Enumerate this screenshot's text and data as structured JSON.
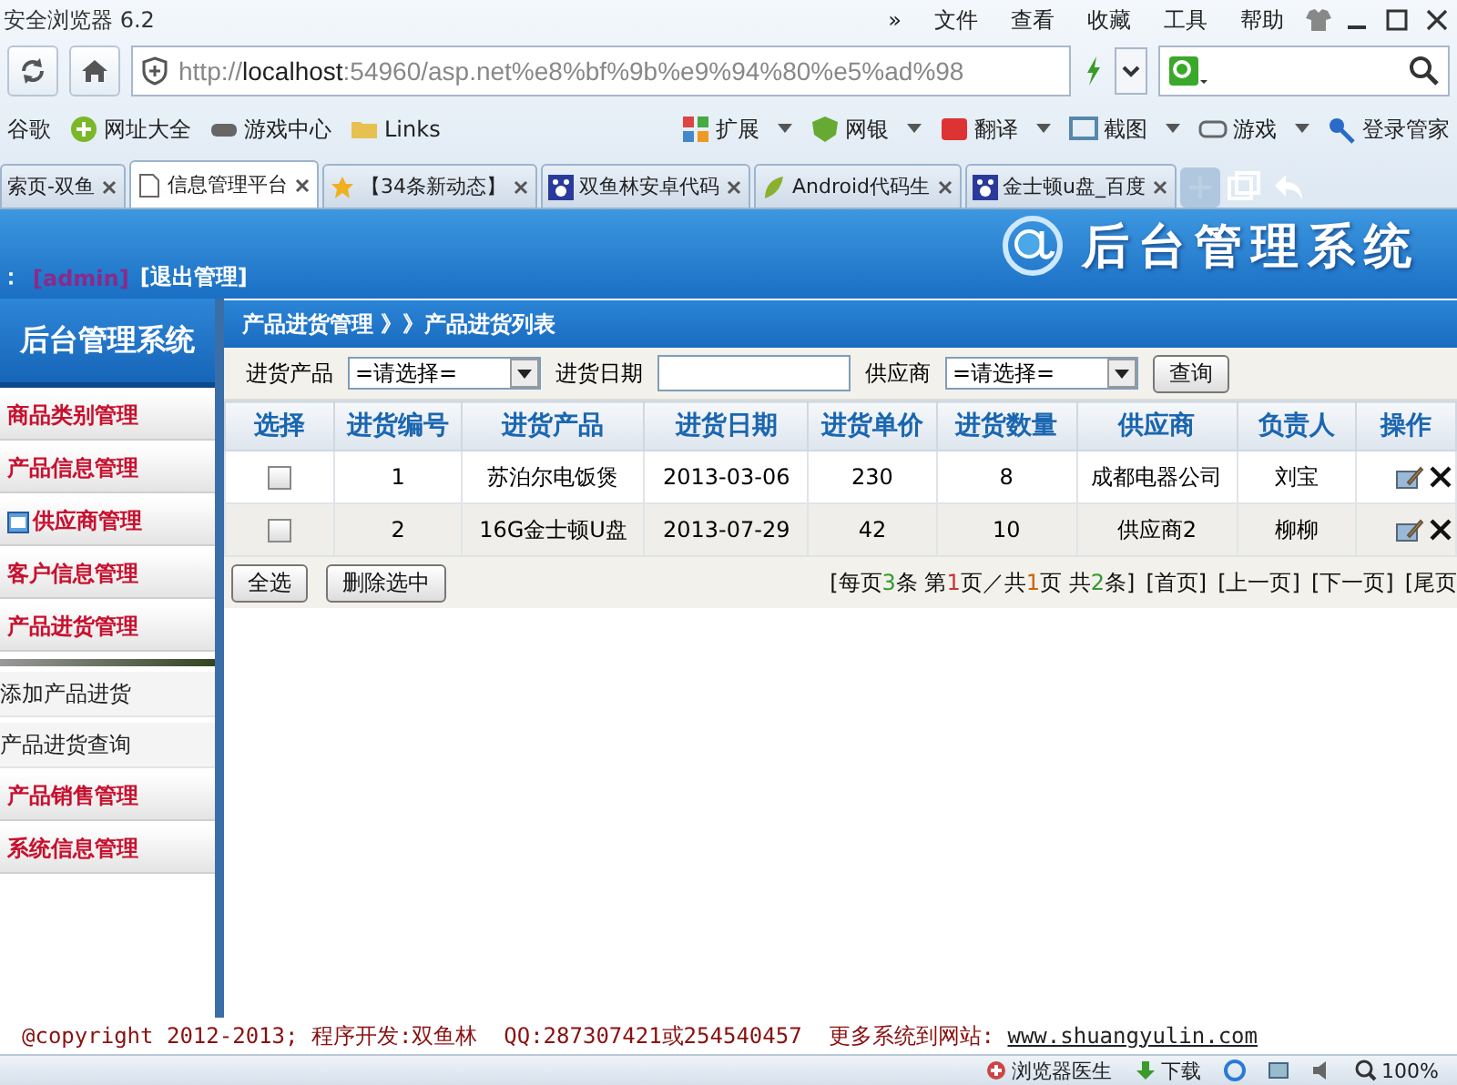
{
  "browser": {
    "title": "安全浏览器 6.2",
    "menu": [
      "»",
      "文件",
      "查看",
      "收藏",
      "工具",
      "帮助"
    ],
    "url_prefix": "http://",
    "url_host": "localhost",
    "url_rest": ":54960/asp.net%e8%bf%9b%e9%94%80%e5%ad%98",
    "bookmarks": [
      "谷歌",
      "网址大全",
      "游戏中心",
      "Links"
    ],
    "tools": [
      "扩展",
      "网银",
      "翻译",
      "截图",
      "游戏",
      "登录管家"
    ],
    "tabs": [
      {
        "label": "索页-双鱼",
        "selected": false
      },
      {
        "label": "信息管理平台",
        "selected": true
      },
      {
        "label": "【34条新动态】",
        "selected": false
      },
      {
        "label": "双鱼林安卓代码",
        "selected": false
      },
      {
        "label": "Android代码生",
        "selected": false
      },
      {
        "label": "金士顿u盘_百度",
        "selected": false
      }
    ]
  },
  "header": {
    "user_label": "：",
    "user": "[admin]",
    "logout": "[退出管理]",
    "logo": "后台管理系统"
  },
  "sidebar": {
    "title": "后台管理系统",
    "items": [
      {
        "label": "商品类别管理",
        "kind": "plain"
      },
      {
        "label": "产品信息管理",
        "kind": "plain"
      },
      {
        "label": "供应商管理",
        "kind": "with-icon"
      },
      {
        "label": "客户信息管理",
        "kind": "plain"
      },
      {
        "label": "产品进货管理",
        "kind": "plain",
        "children": [
          {
            "label": "添加产品进货"
          },
          {
            "label": "产品进货查询"
          }
        ]
      },
      {
        "label": "产品销售管理",
        "kind": "plain"
      },
      {
        "label": "系统信息管理",
        "kind": "plain"
      }
    ]
  },
  "breadcrumb": "产品进货管理 》》产品进货列表",
  "filters": {
    "product_label": "进货产品",
    "product_value": "=请选择=",
    "date_label": "进货日期",
    "supplier_label": "供应商",
    "supplier_value": "=请选择=",
    "search": "查询"
  },
  "table": {
    "columns": [
      "选择",
      "进货编号",
      "进货产品",
      "进货日期",
      "进货单价",
      "进货数量",
      "供应商",
      "负责人",
      "操作"
    ],
    "rows": [
      {
        "checked": false,
        "cells": [
          "",
          "1",
          "苏泊尔电饭煲",
          "2013-03-06",
          "230",
          "8",
          "成都电器公司",
          "刘宝"
        ]
      },
      {
        "checked": false,
        "cells": [
          "",
          "2",
          "16G金士顿U盘",
          "2013-07-29",
          "42",
          "10",
          "供应商2",
          "柳柳"
        ]
      }
    ]
  },
  "actions": [
    "全选",
    "删除选中"
  ],
  "pager": {
    "info": [
      {
        "text": "[每页"
      },
      {
        "text": "3",
        "color": "#339933"
      },
      {
        "text": "条 第"
      },
      {
        "text": "1",
        "color": "#cc3333"
      },
      {
        "text": "页／共"
      },
      {
        "text": "1",
        "color": "#cc6600"
      },
      {
        "text": "页 共"
      },
      {
        "text": "2",
        "color": "#339933"
      },
      {
        "text": "条]"
      }
    ],
    "links": [
      "[首页]",
      "[上一页]",
      "[下一页]",
      "[尾页"
    ]
  },
  "footer": {
    "text": "@copyright 2012-2013; 程序开发:双鱼林  QQ:287307421或254540457  更多系统到网站: ",
    "link": "www.shuangyulin.com"
  },
  "status": {
    "items": [
      "浏览器医生",
      "下载"
    ],
    "zoom": "100%"
  }
}
